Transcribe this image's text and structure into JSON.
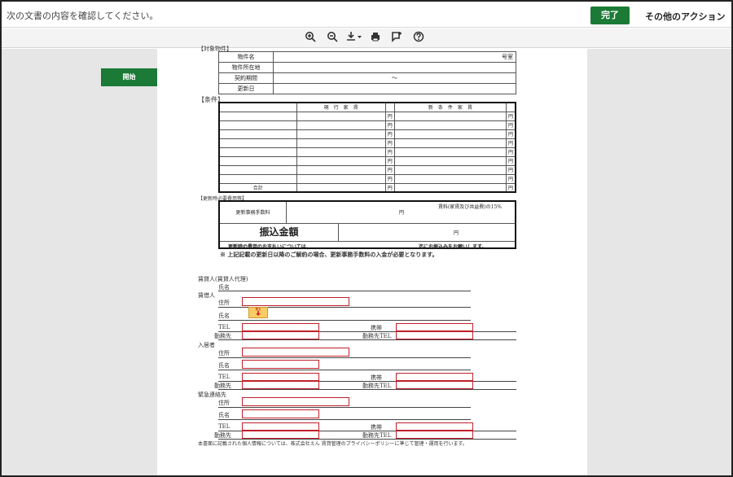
{
  "header": {
    "instruction": "次の文書の内容を確認してください。",
    "finish_label": "完了",
    "other_actions_label": "その他のアクション"
  },
  "toolbar": {
    "icons": [
      "zoom-in-icon",
      "zoom-out-icon",
      "download-icon",
      "print-icon",
      "comment-icon",
      "help-icon"
    ]
  },
  "side": {
    "start_label": "開始"
  },
  "document": {
    "property_heading": "【対象物件】",
    "property_rows": [
      "物件名",
      "物件所在地",
      "契約期間",
      "更新日"
    ],
    "room_suffix": "号室",
    "period_separator": "～",
    "conditions_heading": "【条件】",
    "current_rent": "現　行　家　賃",
    "new_rent": "新　条　件　家　賃",
    "yen": "円",
    "total": "合計",
    "fee_heading": "【更新時必要費用等】",
    "renewal_fee": "更新事務手数料",
    "fee_rate": "賃料(家賃及び共益費)の15%",
    "transfer_amount": "振込金額",
    "payment_note_left": "更新時の費用のお支払いについては、",
    "payment_note_right": "迄にお振込みをお願いします。",
    "notice": "※ 上記記載の更新日以降のご解約の場合、更新事務手数料の入金が必要となります。",
    "lessor": "賃貸人(賃貸人代理)",
    "name": "氏名",
    "lessee": "賃借人",
    "address": "住所",
    "tel": "TEL",
    "mobile": "携帯",
    "workplace": "勤務先",
    "workplace_tel": "勤務先TEL",
    "resident": "入居者",
    "emergency": "緊急連絡先",
    "privacy": "本書面に記載された個人情報については、株式会社えん 賃貸管理のプライバシーポリシーに準じて管理・運用を行います。"
  }
}
